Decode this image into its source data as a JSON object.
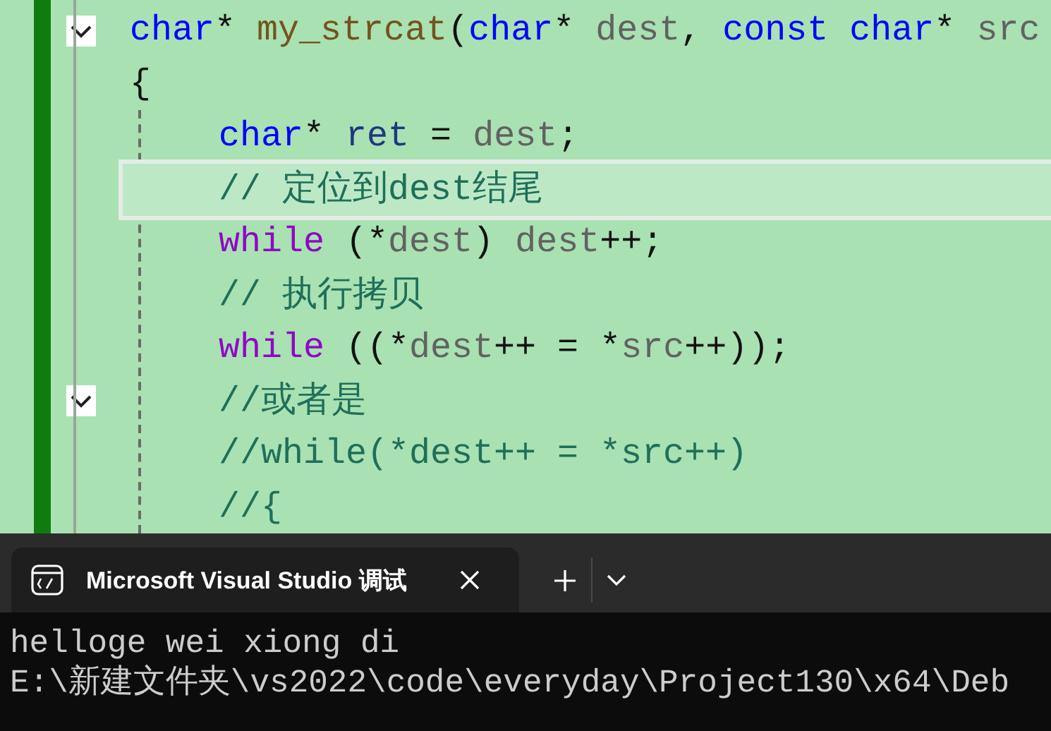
{
  "editor": {
    "lines": [
      {
        "foldable": true,
        "current": false,
        "tokens": [
          {
            "kind": "keyword",
            "text": "char"
          },
          {
            "kind": "plain",
            "text": "* "
          },
          {
            "kind": "function",
            "text": "my_strcat"
          },
          {
            "kind": "plain",
            "text": "("
          },
          {
            "kind": "keyword",
            "text": "char"
          },
          {
            "kind": "plain",
            "text": "* "
          },
          {
            "kind": "param",
            "text": "dest"
          },
          {
            "kind": "plain",
            "text": ", "
          },
          {
            "kind": "keyword",
            "text": "const char"
          },
          {
            "kind": "plain",
            "text": "* "
          },
          {
            "kind": "param",
            "text": "src"
          }
        ]
      },
      {
        "foldable": false,
        "current": false,
        "tokens": [
          {
            "kind": "plain",
            "text": "{"
          }
        ],
        "children": [
          {
            "foldable": false,
            "current": false,
            "tokens": [
              {
                "kind": "keyword",
                "text": "char"
              },
              {
                "kind": "plain",
                "text": "* "
              },
              {
                "kind": "local",
                "text": "ret"
              },
              {
                "kind": "plain",
                "text": " = "
              },
              {
                "kind": "param",
                "text": "dest"
              },
              {
                "kind": "plain",
                "text": ";"
              }
            ]
          },
          {
            "foldable": false,
            "current": true,
            "tokens": [
              {
                "kind": "comment",
                "text": "// 定位到dest结尾"
              }
            ]
          },
          {
            "foldable": false,
            "current": false,
            "tokens": [
              {
                "kind": "control",
                "text": "while"
              },
              {
                "kind": "plain",
                "text": " (*"
              },
              {
                "kind": "param",
                "text": "dest"
              },
              {
                "kind": "plain",
                "text": ") "
              },
              {
                "kind": "param",
                "text": "dest"
              },
              {
                "kind": "plain",
                "text": "++;"
              }
            ]
          },
          {
            "foldable": false,
            "current": false,
            "tokens": [
              {
                "kind": "comment",
                "text": "// 执行拷贝"
              }
            ]
          },
          {
            "foldable": false,
            "current": false,
            "tokens": [
              {
                "kind": "control",
                "text": "while"
              },
              {
                "kind": "plain",
                "text": " ((*"
              },
              {
                "kind": "param",
                "text": "dest"
              },
              {
                "kind": "plain",
                "text": "++ = *"
              },
              {
                "kind": "param",
                "text": "src"
              },
              {
                "kind": "plain",
                "text": "++));"
              }
            ]
          },
          {
            "foldable": true,
            "current": false,
            "tokens": [
              {
                "kind": "comment",
                "text": "//或者是"
              }
            ]
          },
          {
            "foldable": false,
            "current": false,
            "tokens": [
              {
                "kind": "comment",
                "text": "//while(*dest++ = *src++)"
              }
            ]
          },
          {
            "foldable": false,
            "current": false,
            "tokens": [
              {
                "kind": "comment",
                "text": "//{"
              }
            ]
          }
        ]
      }
    ]
  },
  "terminal": {
    "tab": {
      "title": "Microsoft Visual Studio 调试",
      "selected": true
    },
    "output": [
      "helloge wei xiong di",
      "E:\\新建文件夹\\vs2022\\code\\everyday\\Project130\\x64\\Deb"
    ]
  }
}
